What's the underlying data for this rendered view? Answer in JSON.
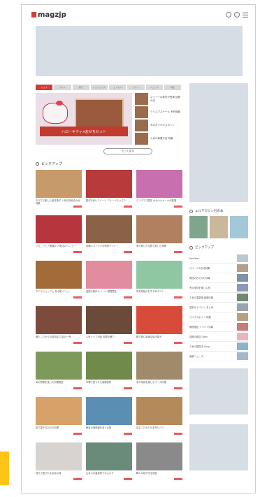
{
  "header": {
    "logo_text": "magzjp",
    "icons": [
      "search-icon",
      "settings-icon",
      "menu-icon"
    ]
  },
  "nav_tabs": [
    "トップ",
    "グルメ",
    "旅行",
    "ショッピング",
    "エンタメ",
    "ライフ",
    "ニュース",
    "特集"
  ],
  "hero": {
    "caption": "ハローキティ×おせちセット"
  },
  "side_news": [
    "スイーツの新作が登場 話題の店",
    "クリスマスケーキ 予約情報",
    "冬のおでかけスポット",
    "人気の和菓子店 特集"
  ],
  "more_button": "もっと見る",
  "section_title": "ピックアップ",
  "cards": [
    {
      "title": "おうちで楽しむ焼き菓子 人気の詰め合わせ特集",
      "color": "#c79a6a"
    },
    {
      "title": "贅沢な赤いスイーツ フルーツたっぷり",
      "color": "#b83a3a"
    },
    {
      "title": "クリスマス限定 かわいいケーキが登場",
      "color": "#c86fb0"
    },
    {
      "title": "いちごフェア開催中 人気店のメニュー",
      "color": "#b7353d"
    },
    {
      "title": "老舗レストランの特別ディナー",
      "color": "#8a6247"
    },
    {
      "title": "落ち着いた空間で楽しむ和食",
      "color": "#b08060"
    },
    {
      "title": "ホテルビュッフェ 冬の新メニュー",
      "color": "#a26b3a"
    },
    {
      "title": "話題の新作スイーツ 期間限定",
      "color": "#e28ca0"
    },
    {
      "title": "年末年始のおすすめギフト",
      "color": "#8fc7a3"
    },
    {
      "title": "職人こだわりの精肉店 注目の一品",
      "color": "#7c4b3b"
    },
    {
      "title": "人気シェフ対談 料理の魅力",
      "color": "#6c4a3a"
    },
    {
      "title": "贈り物に最適な焼き菓子",
      "color": "#d84a3a"
    },
    {
      "title": "旬の野菜を使った料理教室",
      "color": "#7d9a5a"
    },
    {
      "title": "市場で見つけた新鮮食材",
      "color": "#6f8a4a"
    },
    {
      "title": "冬の味覚を楽しむコース料理",
      "color": "#a08a6a"
    },
    {
      "title": "彩り豊かなおせち料理",
      "color": "#d7a26a"
    },
    {
      "title": "絶景の海岸線をめぐる旅",
      "color": "#5a8fb3"
    },
    {
      "title": "店主こだわりの手作りパン",
      "color": "#b48a5a"
    },
    {
      "title": "地元で愛される名店の味",
      "color": "#d7d3d0"
    },
    {
      "title": "山あいの温泉街でのんびり",
      "color": "#6a8a7a"
    },
    {
      "title": "職人の技が光る逸品",
      "color": "#8a8a8a"
    }
  ],
  "sidebar": {
    "magazine_title": "エルマガジン社の本",
    "magazine_colors": [
      "#7fa58f",
      "#c9b89a",
      "#a3c8d8"
    ],
    "pickup_title": "ピックアップ",
    "pickup_items": [
      {
        "label": "NewYear",
        "color": "#bcc7d4"
      },
      {
        "label": "スイーツのお店特集",
        "color": "#b4a08a"
      },
      {
        "label": "関西のおでかけ情報",
        "color": "#7c93a8"
      },
      {
        "label": "冬の味覚を楽しむ旅",
        "color": "#8a9bb5"
      },
      {
        "label": "人気の温泉宿 最新情報",
        "color": "#6f8a6f"
      },
      {
        "label": "週末のイベント まとめ",
        "color": "#9aa4b0"
      },
      {
        "label": "ランチスポット 特集",
        "color": "#b7a17f"
      },
      {
        "label": "期間限定 イベント情報",
        "color": "#c77a7a"
      },
      {
        "label": "話題の新店 Open",
        "color": "#e7b5c0"
      },
      {
        "label": "人気の雑貨店 Shop",
        "color": "#8fb2c8"
      },
      {
        "label": "最新ニュース",
        "color": "#a3b8c9"
      }
    ]
  },
  "accent_color": "#d33a3a"
}
